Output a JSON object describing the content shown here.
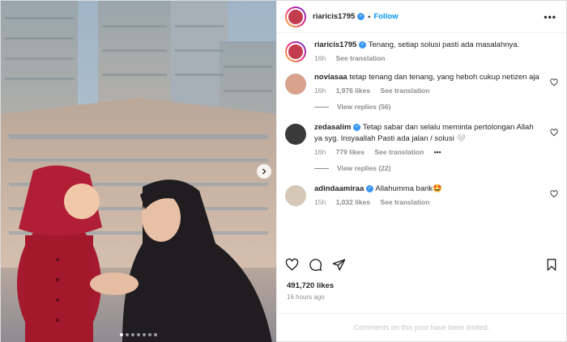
{
  "post": {
    "author": "riaricis1795",
    "follow_label": "Follow",
    "separator": "•",
    "more_label": "•••",
    "carousel_total": 7,
    "carousel_active": 1
  },
  "caption": {
    "author": "riaricis1795",
    "text": "Tenang, setiap solusi pasti ada masalahnya.",
    "time": "16h",
    "translate": "See translation"
  },
  "comments": [
    {
      "author": "noviasaa",
      "text": "tetap tenang dan tenang, yang heboh cukup netizen aja",
      "time": "16h",
      "likes": "1,976 likes",
      "translate": "See translation",
      "replies": "View replies (56)",
      "verified": false
    },
    {
      "author": "zedasalim",
      "text": "Tetap sabar dan selalu meminta pertolongan Allah ya syg. Insyaallah Pasti ada jalan / solusi 🤍",
      "time": "16h",
      "likes": "779 likes",
      "translate": "See translation",
      "more": "•••",
      "replies": "View replies (22)",
      "verified": true
    },
    {
      "author": "adindaamiraa",
      "text": "Allahumma barik🤩",
      "time": "15h",
      "likes": "1,032 likes",
      "translate": "See translation",
      "verified": true
    }
  ],
  "stats": {
    "likes": "491,720 likes",
    "ago": "16 hours ago"
  },
  "footer": {
    "limited": "Comments on this post have been limited."
  },
  "colors": {
    "follow": "#0095f6",
    "verified": "#3897f0",
    "muted": "#8e8e8e"
  },
  "icons": [
    "heart-icon",
    "comment-icon",
    "share-icon",
    "bookmark-icon",
    "chevron-right-icon",
    "verified-icon"
  ]
}
